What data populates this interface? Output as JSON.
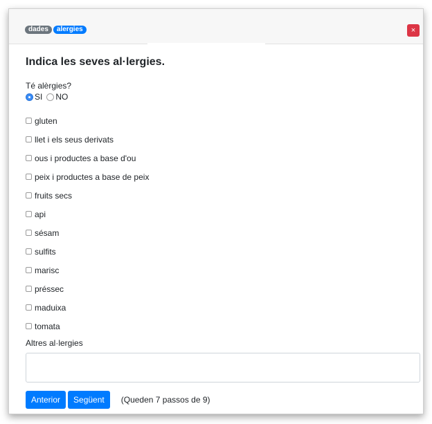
{
  "header": {
    "badges": [
      "dades",
      "alergies"
    ],
    "close_label": "×"
  },
  "form": {
    "title": "Indica les seves al·lergies.",
    "question": "Té alèrgies?",
    "radio_options": [
      {
        "label": "SI",
        "selected": true
      },
      {
        "label": "NO",
        "selected": false
      }
    ],
    "allergies": [
      "gluten",
      "llet i els seus derivats",
      "ous i productes a base d'ou",
      "peix i productes a base de peix",
      "fruits secs",
      "api",
      "sésam",
      "sulfits",
      "marisc",
      "préssec",
      "maduixa",
      "tomata"
    ],
    "other_label": "Altres al·lergies",
    "other_value": ""
  },
  "footer": {
    "prev_label": "Anterior",
    "next_label": "Següent",
    "steps_text": "(Queden 7 passos de 9)"
  },
  "colors": {
    "primary": "#007bff",
    "danger": "#dc3545",
    "secondary": "#6c757d"
  }
}
